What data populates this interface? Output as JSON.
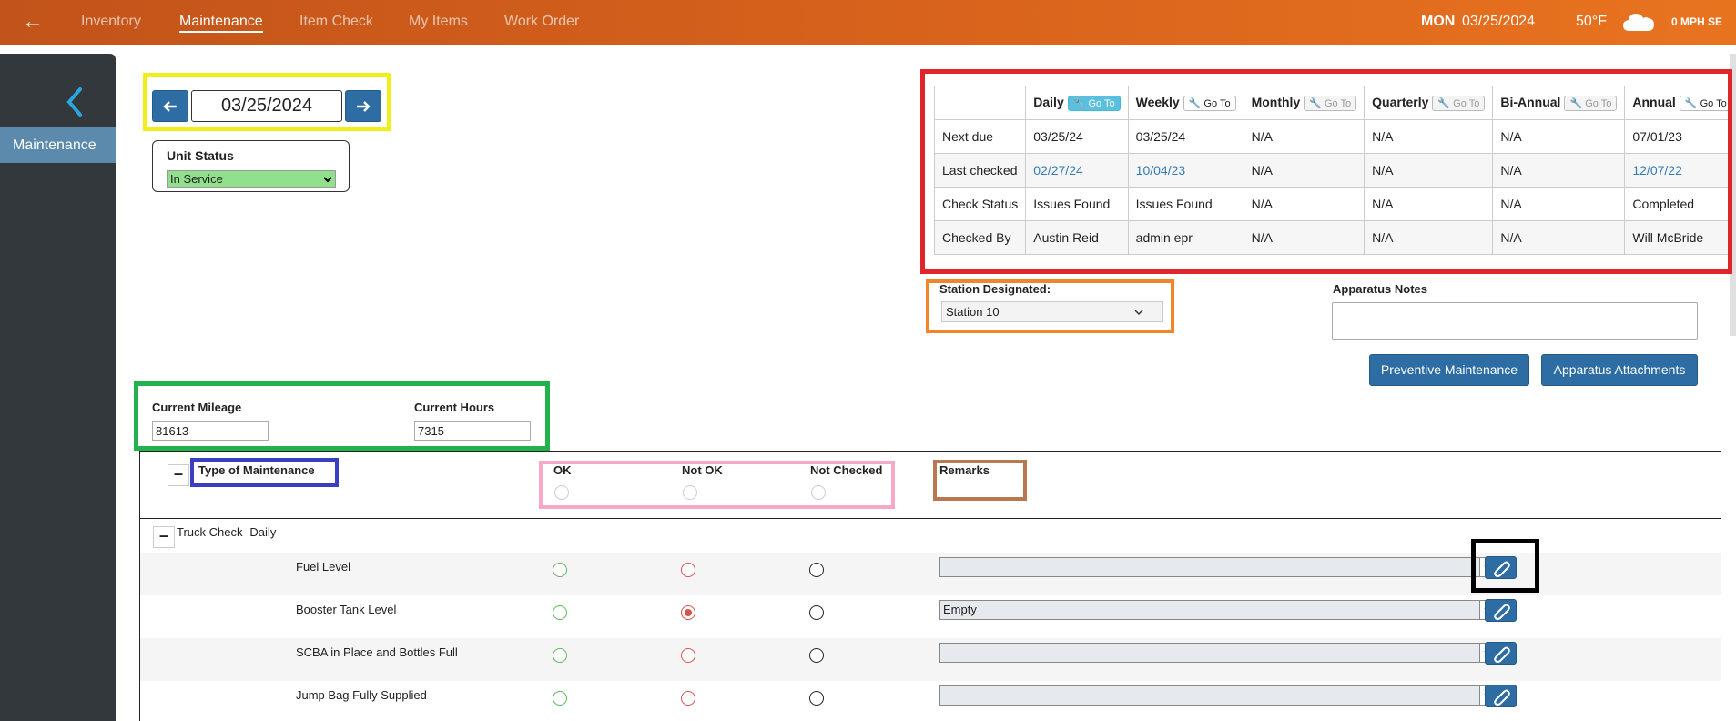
{
  "topbar": {
    "nav": [
      "Inventory",
      "Maintenance",
      "Item Check",
      "My Items",
      "Work Order"
    ],
    "active": "Maintenance",
    "day": "MON",
    "date": "03/25/2024",
    "temp": "50°F",
    "wind": "0 MPH SE",
    "weather_icon": "cloud-icon"
  },
  "sidebar": {
    "item": "Maintenance"
  },
  "date_picker": {
    "value": "03/25/2024"
  },
  "unit_status": {
    "label": "Unit Status",
    "value": "In Service",
    "color": "#90e08c"
  },
  "schedule": {
    "headers": [
      "Daily",
      "Weekly",
      "Monthly",
      "Quarterly",
      "Bi-Annual",
      "Annual"
    ],
    "goto_label": "Go To",
    "rows": [
      {
        "label": "Next due",
        "values": [
          "03/25/24",
          "03/25/24",
          "N/A",
          "N/A",
          "N/A",
          "07/01/23"
        ]
      },
      {
        "label": "Last checked",
        "values": [
          "02/27/24",
          "10/04/23",
          "N/A",
          "N/A",
          "N/A",
          "12/07/22"
        ]
      },
      {
        "label": "Check Status",
        "values": [
          "Issues Found",
          "Issues Found",
          "N/A",
          "N/A",
          "N/A",
          "Completed"
        ]
      },
      {
        "label": "Checked By",
        "values": [
          "Austin Reid",
          "admin epr",
          "N/A",
          "N/A",
          "N/A",
          "Will McBride"
        ]
      }
    ]
  },
  "station": {
    "label": "Station Designated:",
    "value": "Station 10"
  },
  "notes": {
    "label": "Apparatus Notes",
    "value": ""
  },
  "buttons": {
    "preventive": "Preventive Maintenance",
    "attachments": "Apparatus Attachments"
  },
  "mileage": {
    "mileage_label": "Current Mileage",
    "mileage_value": "81613",
    "hours_label": "Current Hours",
    "hours_value": "7315"
  },
  "maintenance": {
    "type_header": "Type of Maintenance",
    "ok_header": "OK",
    "notok_header": "Not OK",
    "nc_header": "Not Checked",
    "remarks_header": "Remarks",
    "section": "Truck Check- Daily",
    "items": [
      {
        "label": "Fuel Level",
        "remark": "",
        "selected": "none"
      },
      {
        "label": "Booster Tank Level",
        "remark": "Empty",
        "selected": "notok"
      },
      {
        "label": "SCBA in Place and Bottles Full",
        "remark": "",
        "selected": "none"
      },
      {
        "label": "Jump Bag Fully Supplied",
        "remark": "",
        "selected": "none"
      }
    ]
  },
  "colors": {
    "topbar": "#d9631c",
    "sidebar": "#33383d",
    "sidebar_active": "#5b8aac",
    "primary": "#2e6da4",
    "ann_yellow": "#f2ee1a",
    "ann_red": "#e0262b",
    "ann_orange": "#f2852a",
    "ann_green": "#22b14c",
    "ann_blue": "#3a3ec2",
    "ann_pink": "#f7a8c8",
    "ann_brown": "#b9794f",
    "ann_black": "#000000"
  }
}
